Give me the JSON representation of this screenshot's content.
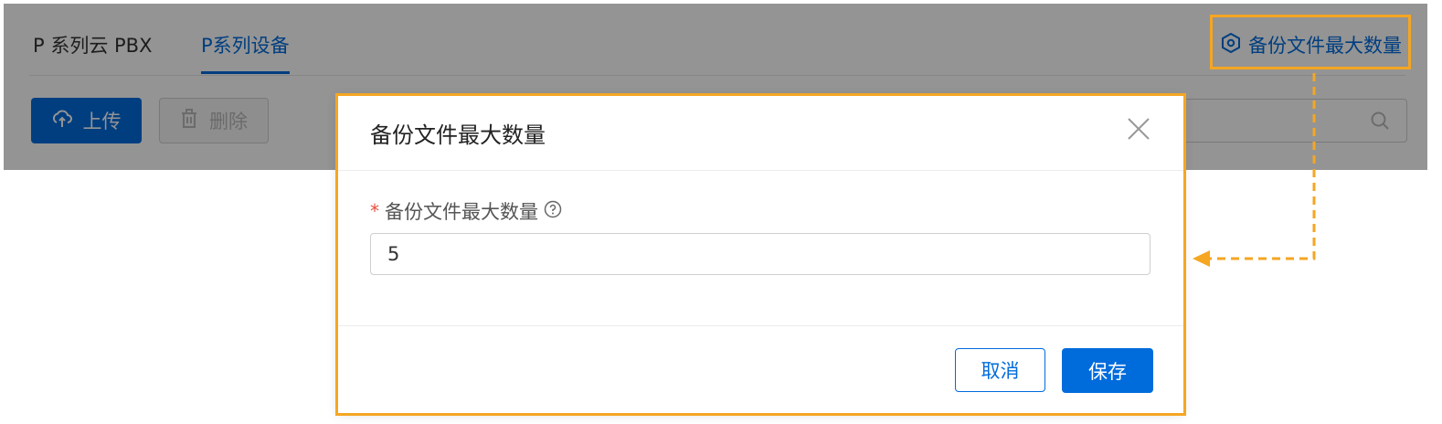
{
  "background": {
    "tabs": [
      {
        "label": "P 系列云 PBX"
      },
      {
        "label": "P系列设备"
      }
    ],
    "backup_link_label": "备份文件最大数量",
    "upload_label": "上传",
    "delete_label": "删除"
  },
  "modal": {
    "title": "备份文件最大数量",
    "field": {
      "required_mark": "*",
      "label": "备份文件最大数量",
      "value": "5"
    },
    "cancel_label": "取消",
    "save_label": "保存"
  },
  "colors": {
    "accent": "#006cdc",
    "highlight": "#f5a623",
    "required": "#e84c3d"
  },
  "icons": [
    "settings-icon",
    "upload-icon",
    "trash-icon",
    "search-icon",
    "close-icon",
    "help-icon"
  ]
}
